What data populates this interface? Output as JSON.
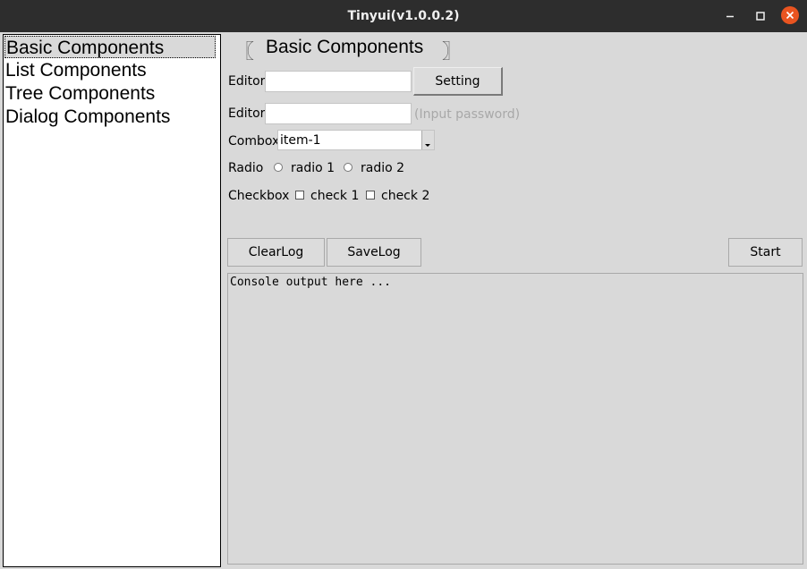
{
  "window": {
    "title": "Tinyui(v1.0.0.2)"
  },
  "sidebar": {
    "items": [
      {
        "label": "Basic Components"
      },
      {
        "label": "List Components"
      },
      {
        "label": "Tree Components"
      },
      {
        "label": "Dialog Components"
      }
    ]
  },
  "main": {
    "heading": "Basic Components",
    "bracket_left": "〖",
    "bracket_right": "〗",
    "editor1": {
      "label": "Editor",
      "value": ""
    },
    "setting_button": "Setting",
    "editor2": {
      "label": "Editor",
      "value": "",
      "hint": "(Input password)"
    },
    "combobox": {
      "label": "Combox",
      "value": "item-1"
    },
    "radio": {
      "label": "Radio",
      "options": [
        "radio 1",
        "radio 2"
      ]
    },
    "checkbox": {
      "label": "Checkbox",
      "options": [
        "check 1",
        "check 2"
      ]
    },
    "buttons": {
      "clear_log": "ClearLog",
      "save_log": "SaveLog",
      "start": "Start"
    },
    "console": {
      "text": "Console output here ..."
    }
  }
}
